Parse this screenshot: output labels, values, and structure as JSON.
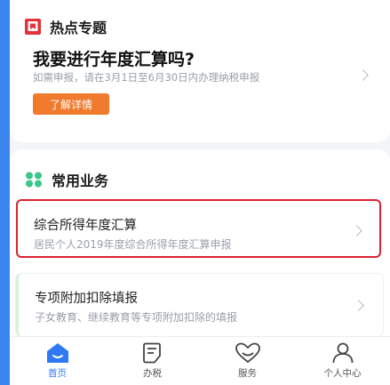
{
  "hot_topics": {
    "section_title": "热点专题",
    "headline": "我要进行年度汇算吗?",
    "subtitle": "如需申报，请在3月1日至6月30日内办理纳税申报",
    "detail_button": "了解详情"
  },
  "common_business": {
    "section_title": "常用业务",
    "items": [
      {
        "title": "综合所得年度汇算",
        "subtitle": "居民个人2019年度综合所得年度汇算申报"
      },
      {
        "title": "专项附加扣除填报",
        "subtitle": "子女教育、继续教育等专项附加扣除的填报"
      }
    ]
  },
  "tabbar": {
    "tabs": [
      {
        "label": "首页",
        "icon": "home-icon"
      },
      {
        "label": "办税",
        "icon": "tax-form-icon"
      },
      {
        "label": "服务",
        "icon": "service-heart-icon"
      },
      {
        "label": "个人中心",
        "icon": "person-icon"
      }
    ]
  },
  "colors": {
    "accent_blue": "#2f7af3",
    "hot_icon_red": "#e5313b",
    "button_orange": "#f07a2d",
    "highlight_red": "#d92330",
    "grid_icon_green": "#3cc68a"
  }
}
